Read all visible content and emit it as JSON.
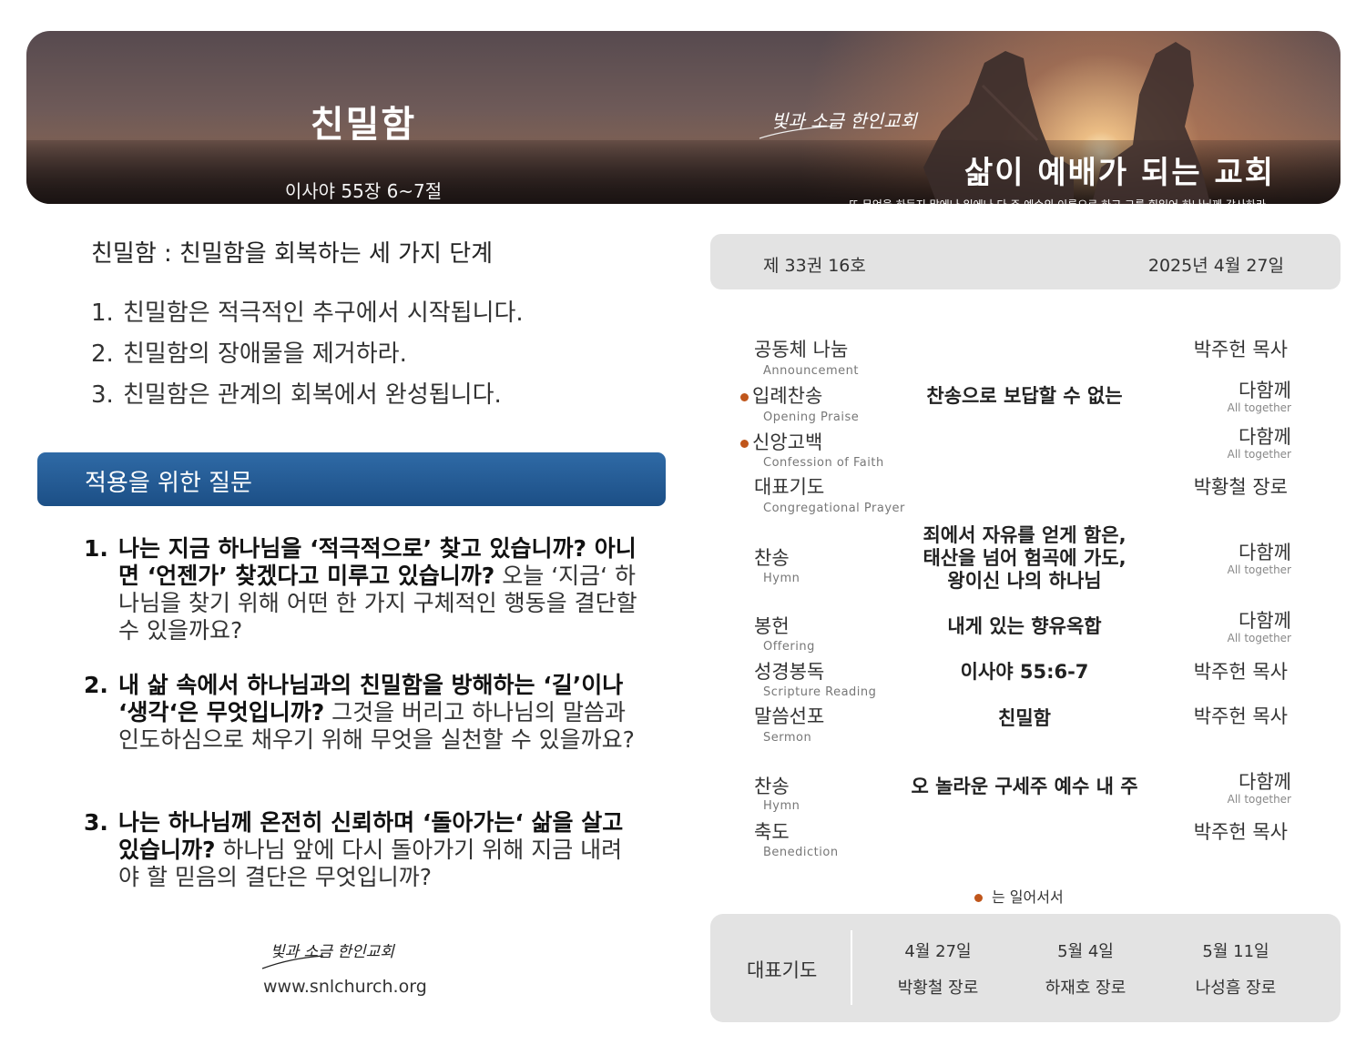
{
  "banner": {
    "title": "친밀함",
    "scripture": "이사야 55장 6~7절",
    "church_logo_text": "빛과 소금 한인교회",
    "motto": "삶이 예배가 되는 교회",
    "verse": "또 무엇을 하든지 말에나 일에나 다 주 예수의 이름으로 하고 그를 힘입어 하나님께 감사하라"
  },
  "outline": {
    "title": "친밀함 : 친밀함을 회복하는 세 가지 단계",
    "items": [
      {
        "num": "1.",
        "text": "친밀함은 적극적인 추구에서 시작됩니다."
      },
      {
        "num": "2.",
        "text": "친밀함의 장애물을 제거하라."
      },
      {
        "num": "3.",
        "text": "친밀함은 관계의 회복에서 완성됩니다."
      }
    ]
  },
  "application": {
    "title": "적용을 위한 질문",
    "questions": [
      {
        "num": "1.",
        "bold": "나는 지금 하나님을 ‘적극적으로’ 찾고 있습니까? 아니면 ‘언젠가’ 찾겠다고 미루고 있습니까?",
        "rest": " 오늘 ‘지금‘ 하나님을 찾기 위해 어떤 한 가지 구체적인 행동을 결단할 수 있을까요?"
      },
      {
        "num": "2.",
        "bold": "내 삶 속에서 하나님과의 친밀함을 방해하는 ‘길’이나 ‘생각‘은 무엇입니까?",
        "rest": " 그것을 버리고 하나님의 말씀과 인도하심으로 채우기 위해 무엇을 실천할 수 있을까요?"
      },
      {
        "num": "3.",
        "bold": "나는 하나님께 온전히 신뢰하며 ‘돌아가는‘ 삶을 살고 있습니까?",
        "rest": " 하나님 앞에 다시 돌아가기 위해 지금 내려야 할 믿음의 결단은 무엇입니까?"
      }
    ]
  },
  "footer": {
    "logo_text": "빛과 소금 한인교회",
    "website": "www.snlchurch.org"
  },
  "issue": {
    "volume": "제 33권 16호",
    "date": "2025년 4월 27일"
  },
  "worship": {
    "items": [
      {
        "ko": "공동체 나눔",
        "en": "Announcement",
        "title": "",
        "leader": "박주헌 목사"
      },
      {
        "ko": "입례찬송",
        "en": "Opening Praise",
        "title": "찬송으로 보답할 수 없는",
        "leader": "다함께",
        "leader_en": "All together"
      },
      {
        "ko": "신앙고백",
        "en": "Confession of Faith",
        "title": "",
        "leader": "다함께",
        "leader_en": "All together"
      },
      {
        "ko": "대표기도",
        "en": "Congregational Prayer",
        "title": "",
        "leader": "박황철 장로"
      },
      {
        "ko": "찬송",
        "en": "Hymn",
        "title_lines": [
          "죄에서 자유를 얻게 함은,",
          "태산을 넘어 험곡에 가도,",
          "왕이신 나의 하나님"
        ],
        "leader": "다함께",
        "leader_en": "All together"
      },
      {
        "ko": "봉헌",
        "en": "Offering",
        "title": "내게 있는 향유옥합",
        "leader": "다함께",
        "leader_en": "All together"
      },
      {
        "ko": "성경봉독",
        "en": "Scripture Reading",
        "title": "이사야 55:6-7",
        "leader": "박주헌 목사"
      },
      {
        "ko": "말씀선포",
        "en": "Sermon",
        "title": "친밀함",
        "leader": "박주헌 목사"
      },
      {
        "ko": "찬송",
        "en": "Hymn",
        "title": "오 놀라운 구세주 예수 내 주",
        "leader": "다함께",
        "leader_en": "All together"
      },
      {
        "ko": "축도",
        "en": "Benediction",
        "title": "",
        "leader": "박주헌 목사"
      }
    ],
    "stand_note": "는 일어서서"
  },
  "prayer": {
    "label": "대표기도",
    "schedule": [
      {
        "date": "4월 27일",
        "person": "박황철 장로"
      },
      {
        "date": "5월 4일",
        "person": "하재호 장로"
      },
      {
        "date": "5월 11일",
        "person": "나성흠 장로"
      }
    ]
  },
  "colors": {
    "accent_blue": "#1c4f86",
    "bullet_orange": "#c0561b",
    "panel_gray": "#e3e3e3"
  }
}
